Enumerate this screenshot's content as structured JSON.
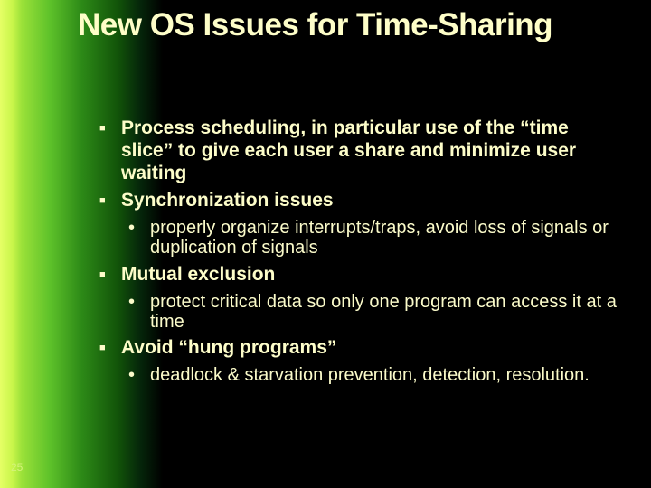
{
  "title": "New OS Issues for Time-Sharing",
  "bullets": {
    "b1": "Process scheduling, in particular use of the “time slice” to give each user a share and minimize user waiting",
    "b2": "Synchronization issues",
    "b2a": "properly organize interrupts/traps, avoid loss of signals or duplication of signals",
    "b3": "Mutual exclusion",
    "b3a": "protect critical data so only one program can access it at a time",
    "b4": "Avoid “hung programs”",
    "b4a": "deadlock & starvation prevention, detection, resolution."
  },
  "page_number": "25"
}
